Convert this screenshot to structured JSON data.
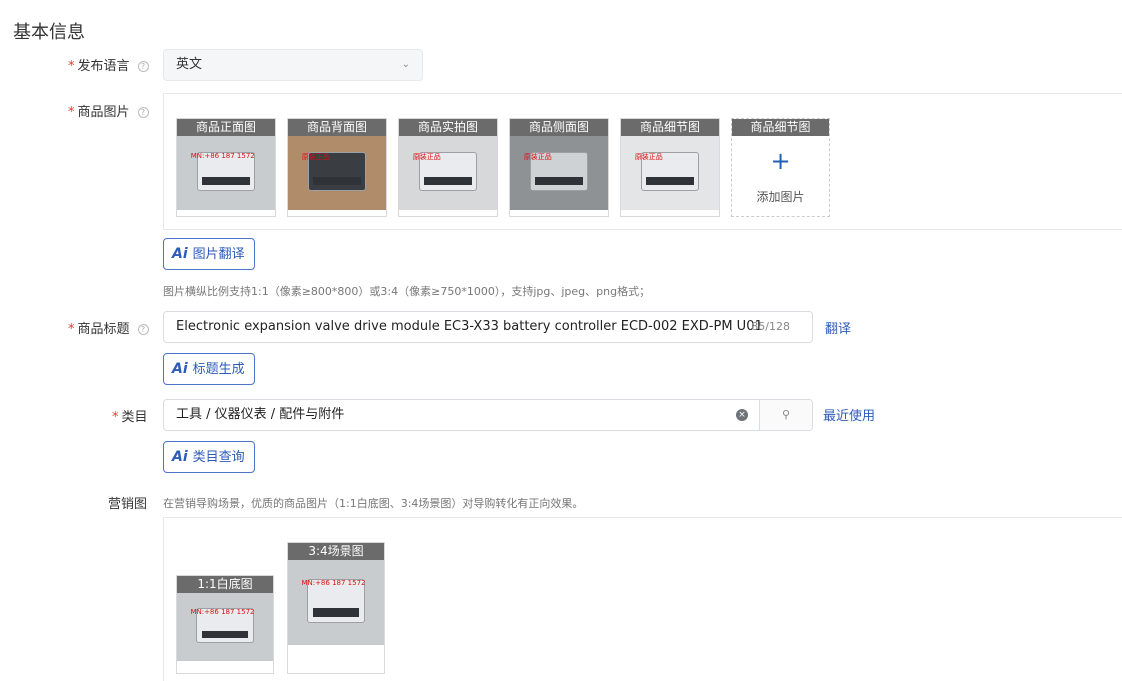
{
  "section_title": "基本信息",
  "language": {
    "label": "发布语言",
    "value": "英文"
  },
  "images": {
    "label": "商品图片",
    "thumbs": [
      "商品正面图",
      "商品背面图",
      "商品实拍图",
      "商品侧面图",
      "商品细节图"
    ],
    "add_caption": "商品细节图",
    "add_text": "添加图片",
    "ai_button": "图片翻译",
    "hint": "图片横纵比例支持1:1（像素≥800*800）或3:4（像素≥750*1000），支持jpg、jpeg、png格式；"
  },
  "title": {
    "label": "商品标题",
    "value": "Electronic expansion valve drive module EC3-X33 battery controller ECD-002 EXD-PM U01",
    "count": "85/128",
    "translate_link": "翻译",
    "ai_button": "标题生成"
  },
  "category": {
    "label": "类目",
    "value": "工具 / 仪器仪表 / 配件与附件",
    "recent_link": "最近使用",
    "ai_button": "类目查询"
  },
  "marketing": {
    "label": "营销图",
    "hint": "在营销导购场景，优质的商品图片（1:1白底图、3:4场景图）对导购转化有正向效果。",
    "square_caption": "1:1白底图",
    "portrait_caption": "3:4场景图"
  },
  "icons": {
    "help": "help-circle-icon",
    "chevron": "chevron-down-icon",
    "clear": "clear-icon",
    "search": "search-icon",
    "plus": "plus-icon",
    "ai": "ai-icon"
  },
  "colors": {
    "primary": "#2d5bb9",
    "required": "#e23b2e"
  }
}
